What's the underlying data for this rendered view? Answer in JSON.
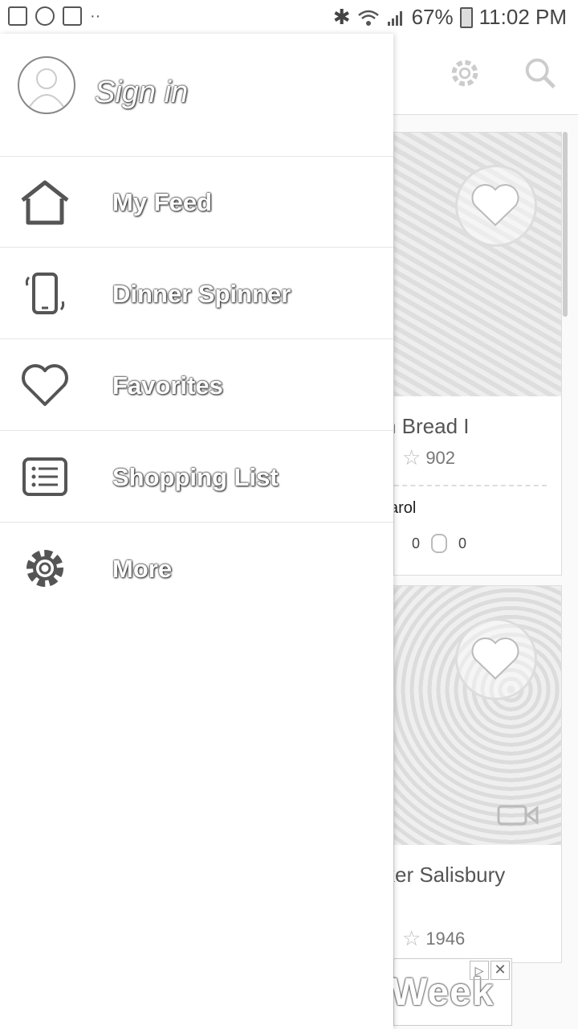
{
  "status_bar": {
    "battery": "67%",
    "time": "11:02 PM",
    "dots": "··"
  },
  "drawer": {
    "sign_in": "Sign in",
    "items": [
      {
        "label": "My Feed",
        "icon": "home-icon"
      },
      {
        "label": "Dinner Spinner",
        "icon": "phone-shake-icon"
      },
      {
        "label": "Favorites",
        "icon": "heart-icon"
      },
      {
        "label": "Shopping List",
        "icon": "list-icon"
      },
      {
        "label": "More",
        "icon": "gear-icon"
      }
    ]
  },
  "background": {
    "cards": [
      {
        "title": "n Bread I",
        "rating_count": "902",
        "author": "arol",
        "stat_a": "0",
        "stat_b": "0"
      },
      {
        "title": "ker Salisbury",
        "rating_count": "1946"
      }
    ],
    "ad_text": "Week",
    "ad_close": "✕",
    "ad_choices": "▷"
  }
}
